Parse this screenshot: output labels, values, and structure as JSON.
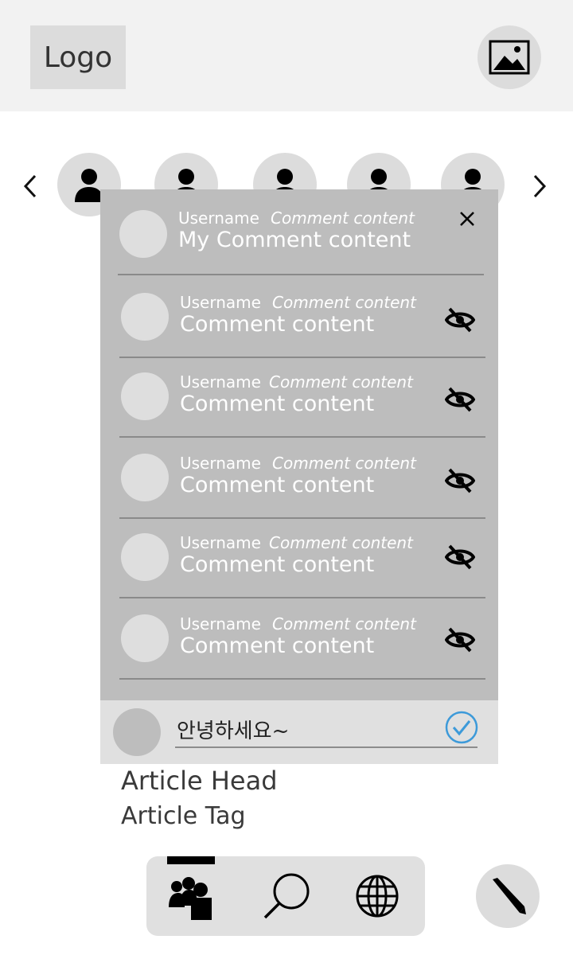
{
  "header": {
    "logo_label": "Logo",
    "image_icon": "image-icon"
  },
  "carousel": {
    "prev_icon": "chevron-left-icon",
    "next_icon": "chevron-right-icon",
    "avatar_icon": "person-icon",
    "avatar_count": 5
  },
  "comments": {
    "close_icon": "close-icon",
    "my_comment": {
      "username": "Username",
      "meta": "Comment content",
      "text": "My Comment content"
    },
    "items": [
      {
        "username": "Username",
        "meta": "Comment content",
        "text": "Comment content",
        "action_icon": "eye-off-icon"
      },
      {
        "username": "Username",
        "meta": "Comment content",
        "text": "Comment content",
        "action_icon": "eye-off-icon"
      },
      {
        "username": "Username",
        "meta": "Comment content",
        "text": " Comment content",
        "action_icon": "eye-off-icon"
      },
      {
        "username": "Username",
        "meta": "Comment content",
        "text": "Comment content",
        "action_icon": "eye-off-icon"
      },
      {
        "username": "Username",
        "meta": "Comment content",
        "text": "Comment content",
        "action_icon": "eye-off-icon"
      }
    ],
    "input": {
      "value": "안녕하세요~",
      "submit_icon": "check-circle-icon"
    }
  },
  "article": {
    "head": "Article Head",
    "tag": "Article Tag"
  },
  "bottom_nav": {
    "items": [
      {
        "name": "people-icon",
        "active": true
      },
      {
        "name": "search-icon",
        "active": false
      },
      {
        "name": "globe-icon",
        "active": false
      }
    ],
    "write_icon": "pencil-icon"
  },
  "colors": {
    "header_bg": "#f2f2f2",
    "panel_bg": "#bdbdbd",
    "input_bg": "#e0e0e0",
    "accent": "#3d9ad9"
  }
}
